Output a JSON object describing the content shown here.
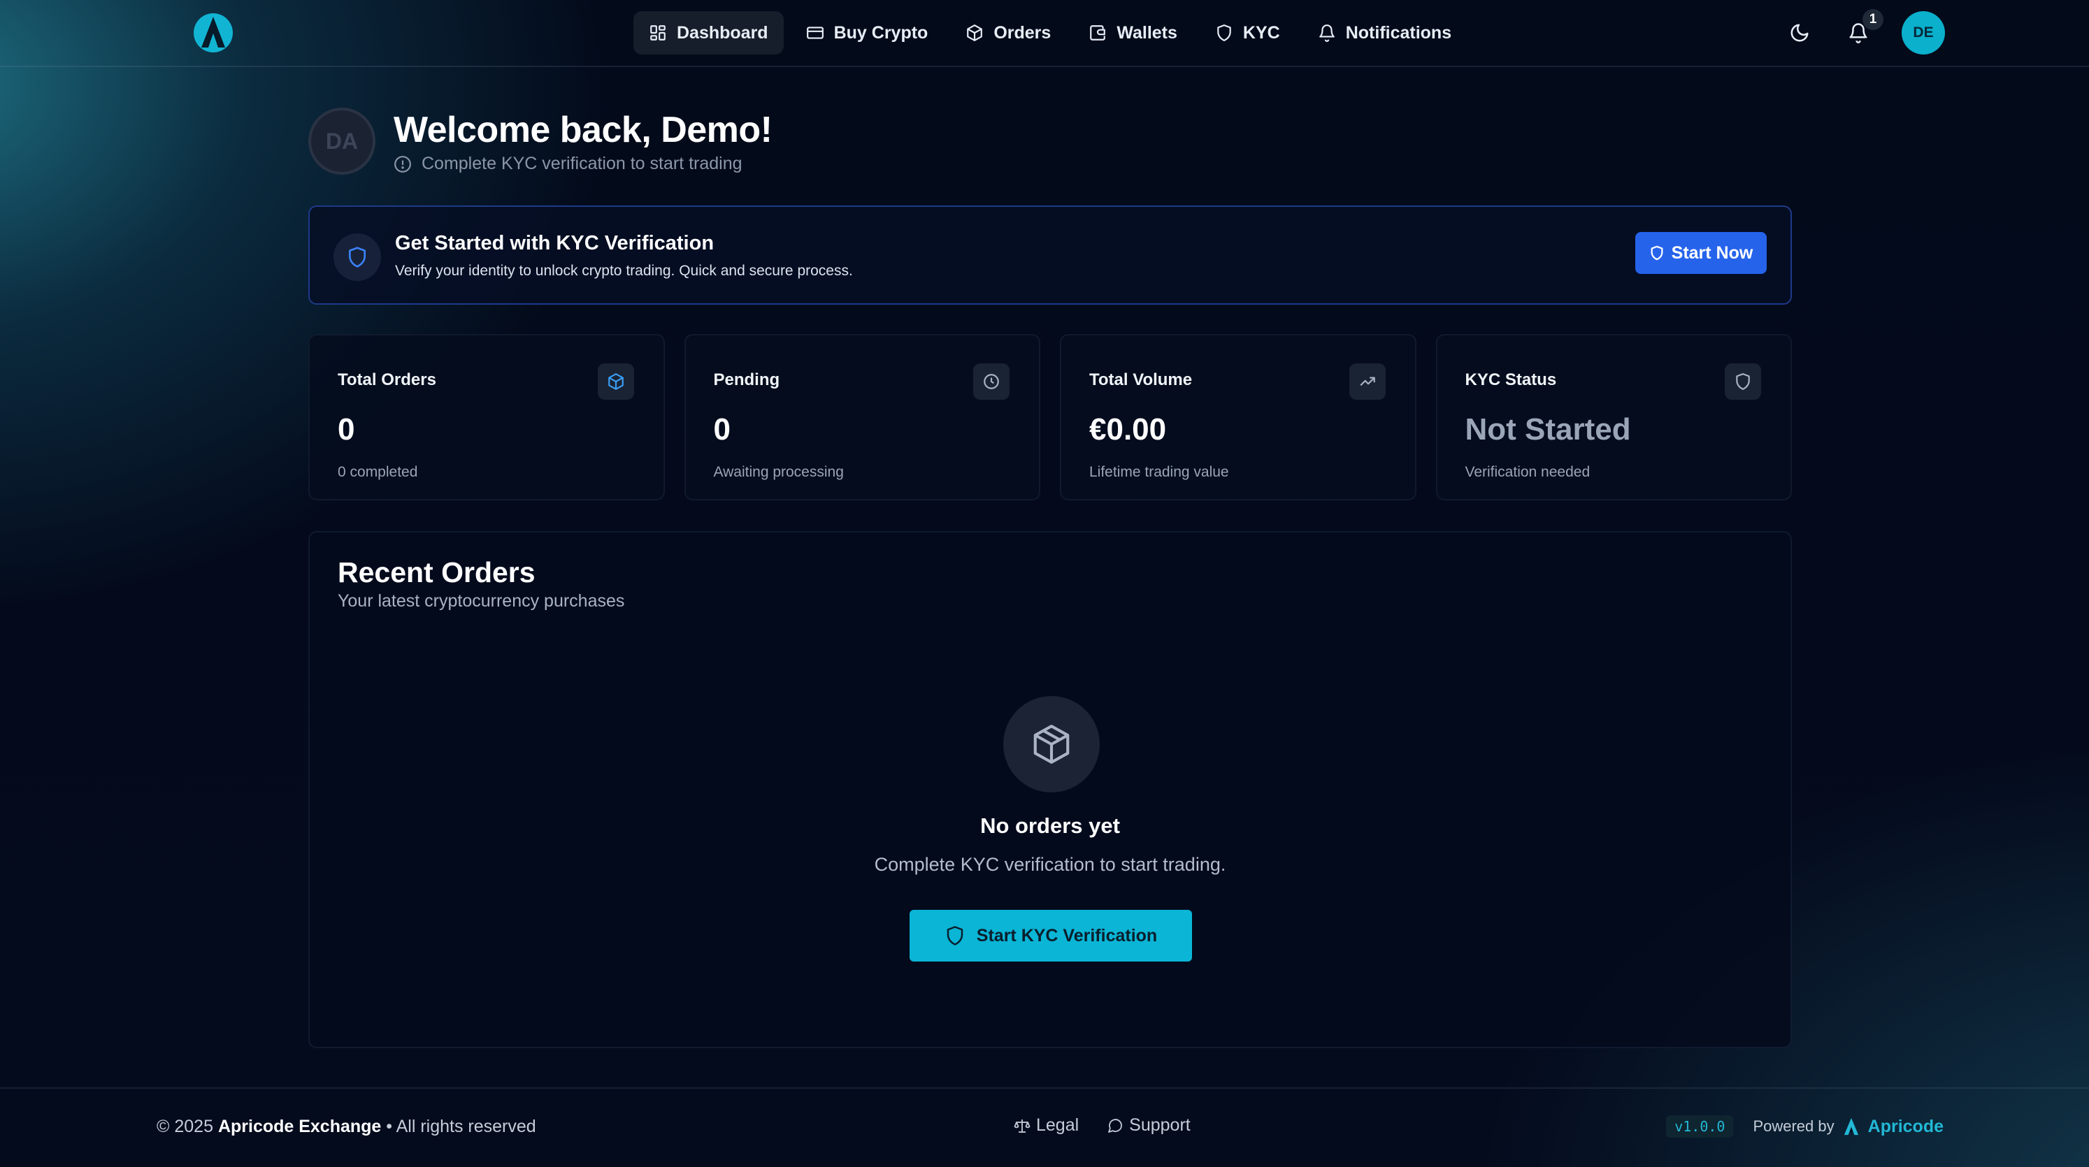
{
  "nav": {
    "items": [
      {
        "label": "Dashboard",
        "icon": "dashboard-icon",
        "active": true
      },
      {
        "label": "Buy Crypto",
        "icon": "credit-card-icon"
      },
      {
        "label": "Orders",
        "icon": "box-icon"
      },
      {
        "label": "Wallets",
        "icon": "wallet-icon"
      },
      {
        "label": "KYC",
        "icon": "shield-icon"
      },
      {
        "label": "Notifications",
        "icon": "bell-icon"
      }
    ],
    "notification_count": "1",
    "user_initials": "DE"
  },
  "welcome": {
    "avatar_initials": "DA",
    "title": "Welcome back, Demo!",
    "subtitle": "Complete KYC verification to start trading"
  },
  "kyc_banner": {
    "title": "Get Started with KYC Verification",
    "subtitle": "Verify your identity to unlock crypto trading. Quick and secure process.",
    "button_label": "Start Now"
  },
  "stats": [
    {
      "label": "Total Orders",
      "value": "0",
      "hint": "0 completed",
      "icon": "box-icon"
    },
    {
      "label": "Pending",
      "value": "0",
      "hint": "Awaiting processing",
      "icon": "clock-icon"
    },
    {
      "label": "Total Volume",
      "value": "€0.00",
      "hint": "Lifetime trading value",
      "icon": "trending-up-icon"
    },
    {
      "label": "KYC Status",
      "value": "Not Started",
      "hint": "Verification needed",
      "icon": "shield-icon"
    }
  ],
  "recent_orders": {
    "title": "Recent Orders",
    "subtitle": "Your latest cryptocurrency purchases",
    "empty_title": "No orders yet",
    "empty_subtitle": "Complete KYC verification to start trading.",
    "cta_label": "Start KYC Verification"
  },
  "footer": {
    "copyright_prefix": "© 2025",
    "company": "Apricode Exchange",
    "copyright_suffix": "• All rights reserved",
    "links": [
      {
        "label": "Legal",
        "icon": "scale-icon"
      },
      {
        "label": "Support",
        "icon": "chat-icon"
      }
    ],
    "version": "v1.0.0",
    "powered_by": "Powered by",
    "brand": "Apricode"
  },
  "colors": {
    "accent": "#0ab5d6",
    "primary_button": "#2563eb",
    "background": "#040b1d"
  }
}
